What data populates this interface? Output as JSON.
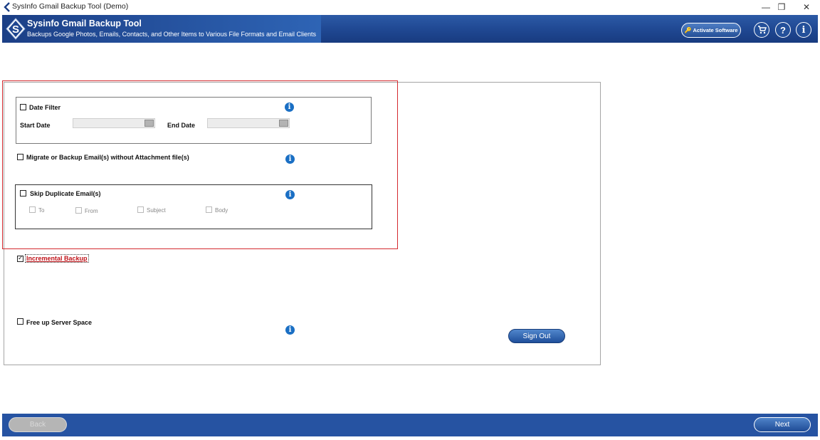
{
  "window": {
    "title": "SysInfo Gmail Backup Tool (Demo)",
    "minimize": "—",
    "restore": "❐",
    "close": "✕"
  },
  "header": {
    "app_name": "Sysinfo Gmail Backup Tool",
    "subtitle": "Backups Google Photos, Emails, Contacts, and Other Items to Various File Formats and Email Clients",
    "logo_letter": "S",
    "activate_label": "Activate Software",
    "cart_icon": "cart-icon",
    "help_glyph": "?",
    "info_glyph": "i",
    "accent_color": "#1f4791"
  },
  "options": {
    "date_filter": {
      "label": "Date Filter",
      "checked": false,
      "start_label": "Start Date",
      "start_value": "",
      "end_label": "End Date",
      "end_value": ""
    },
    "without_attachment": {
      "label": "Migrate or Backup Email(s) without Attachment file(s)",
      "checked": false
    },
    "skip_duplicate": {
      "label": "Skip Duplicate Email(s)",
      "checked": false,
      "fields": [
        "To",
        "From",
        "Subject",
        "Body"
      ]
    },
    "incremental_backup": {
      "label": "Incremental Backup",
      "checked": true
    },
    "free_up_space": {
      "label": "Free up Server Space",
      "checked": false
    },
    "info_glyph": "i"
  },
  "buttons": {
    "sign_out": "Sign Out",
    "back": "Back",
    "next": "Next"
  },
  "colors": {
    "highlight_border": "#d42a2f",
    "info_icon": "#1a6fc4",
    "footer": "#2653a2"
  }
}
